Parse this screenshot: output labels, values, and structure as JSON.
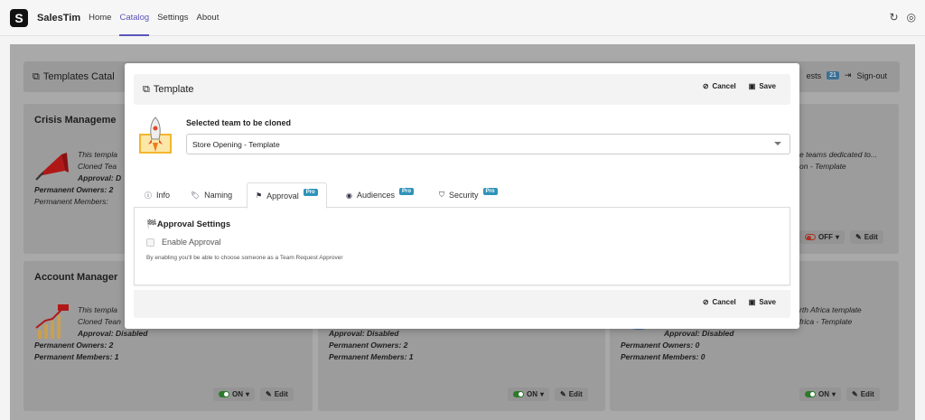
{
  "nav": {
    "brand": "SalesTim",
    "logo": "S",
    "links": [
      "Home",
      "Catalog",
      "Settings",
      "About"
    ],
    "active": "Catalog",
    "refresh_icon": "↻",
    "globe_icon": "◎"
  },
  "page": {
    "header_title": "Templates Catal",
    "requests_label": "ests",
    "requests_count": "21",
    "signout_label": "Sign-out"
  },
  "cards": {
    "crisis": {
      "title": "Crisis Manageme",
      "desc1": "This templa",
      "desc2": "Cloned Tea",
      "approval": "Approval: D",
      "owners": "Permanent Owners: 2",
      "members": "Permanent Members:"
    },
    "right_top": {
      "desc1": "e teams dedicated to...",
      "desc2": "on - Template",
      "toggle": "OFF",
      "edit": "Edit"
    },
    "account": {
      "title": "Account Manager",
      "desc1": "This templa",
      "desc2": "Cloned Tean",
      "approval": "Approval: Disabled",
      "owners": "Permanent Owners: 2",
      "members": "Permanent Members: 1",
      "toggle": "ON",
      "edit": "Edit"
    },
    "middle": {
      "approval": "Approval: Disabled",
      "owners": "Permanent Owners: 2",
      "members": "Permanent Members: 1",
      "toggle": "ON",
      "edit": "Edit"
    },
    "africa": {
      "desc1": "rth Africa template",
      "desc2": "frica - Template",
      "approval": "Approval: Disabled",
      "owners": "Permanent Owners: 0",
      "members": "Permanent Members: 0",
      "toggle": "ON",
      "edit": "Edit"
    }
  },
  "modal": {
    "title": "Template",
    "cancel": "Cancel",
    "save": "Save",
    "selected_label": "Selected team to be cloned",
    "selected_value": "Store Opening - Template",
    "tabs": [
      {
        "label": "Info",
        "icon": "info-icon",
        "pro": ""
      },
      {
        "label": "Naming",
        "icon": "tag-icon",
        "pro": ""
      },
      {
        "label": "Approval",
        "icon": "flag-icon",
        "pro": "Pro"
      },
      {
        "label": "Audiences",
        "icon": "target-icon",
        "pro": "Pro"
      },
      {
        "label": "Security",
        "icon": "shield-icon",
        "pro": "Pro"
      }
    ],
    "active_tab": "Approval",
    "approval_title": "Approval Settings",
    "enable_label": "Enable Approval",
    "enable_checked": false,
    "hint": "By enabling you'll be able to choose someone as a Team Request Approver"
  },
  "colors": {
    "accent": "#5a55b9",
    "pro_badge": "#2f93b9",
    "toggle_on": "#2c7a2c"
  }
}
